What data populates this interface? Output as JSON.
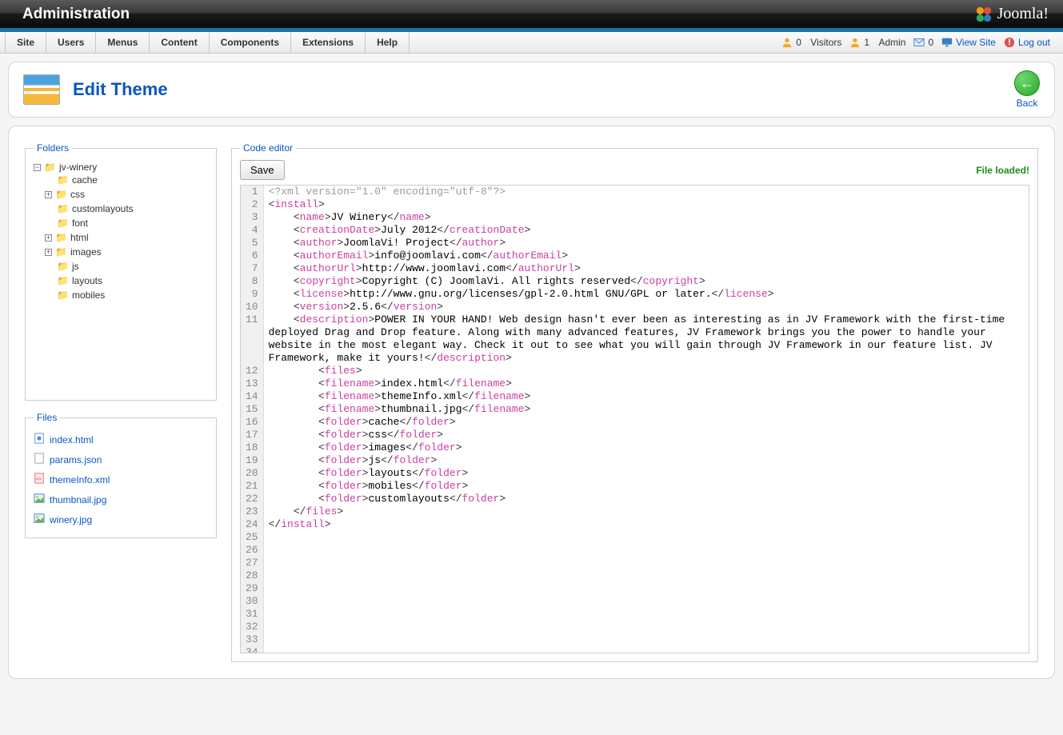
{
  "header": {
    "title": "Administration",
    "brand": "Joomla!"
  },
  "menu": {
    "items": [
      "Site",
      "Users",
      "Menus",
      "Content",
      "Components",
      "Extensions",
      "Help"
    ],
    "right": {
      "visitors_count": "0",
      "visitors_label": "Visitors",
      "admin_count": "1",
      "admin_label": "Admin",
      "mail_count": "0",
      "view_site": "View Site",
      "logout": "Log out"
    }
  },
  "page": {
    "title": "Edit Theme",
    "back_label": "Back"
  },
  "panels": {
    "folders_legend": "Folders",
    "files_legend": "Files",
    "editor_legend": "Code editor"
  },
  "tree": {
    "root": "jv-winery",
    "children": [
      {
        "name": "cache",
        "expandable": false
      },
      {
        "name": "css",
        "expandable": true
      },
      {
        "name": "customlayouts",
        "expandable": false
      },
      {
        "name": "font",
        "expandable": false
      },
      {
        "name": "html",
        "expandable": true
      },
      {
        "name": "images",
        "expandable": true
      },
      {
        "name": "js",
        "expandable": false
      },
      {
        "name": "layouts",
        "expandable": false
      },
      {
        "name": "mobiles",
        "expandable": false
      }
    ]
  },
  "files": [
    "index.html",
    "params.json",
    "themeInfo.xml",
    "thumbnail.jpg",
    "winery.jpg"
  ],
  "editor": {
    "save_label": "Save",
    "status": "File loaded!",
    "total_lines": 34,
    "code_lines": [
      {
        "n": 1,
        "type": "comment",
        "raw": "<?xml version=\"1.0\" encoding=\"utf-8\"?>"
      },
      {
        "n": 2,
        "indent": 0,
        "open": "install"
      },
      {
        "n": 3,
        "indent": 1,
        "open": "name",
        "text": "JV Winery",
        "close": "name"
      },
      {
        "n": 4,
        "indent": 1,
        "open": "creationDate",
        "text": "July 2012",
        "close": "creationDate"
      },
      {
        "n": 5,
        "indent": 1,
        "open": "author",
        "text": "JoomlaVi! Project",
        "close": "author"
      },
      {
        "n": 6,
        "indent": 1,
        "open": "authorEmail",
        "text": "info@joomlavi.com",
        "close": "authorEmail"
      },
      {
        "n": 7,
        "indent": 1,
        "open": "authorUrl",
        "text": "http://www.joomlavi.com",
        "close": "authorUrl"
      },
      {
        "n": 8,
        "indent": 1,
        "open": "copyright",
        "text": "Copyright (C) JoomlaVi. All rights reserved",
        "close": "copyright"
      },
      {
        "n": 9,
        "indent": 1,
        "open": "license",
        "text": "http://www.gnu.org/licenses/gpl-2.0.html GNU/GPL or later.",
        "close": "license"
      },
      {
        "n": 10,
        "indent": 1,
        "open": "version",
        "text": "2.5.6",
        "close": "version"
      },
      {
        "n": 11,
        "indent": 1,
        "open": "description",
        "text": "POWER IN YOUR HAND! Web design hasn't ever been as interesting as in JV Framework with the first-time deployed Drag and Drop feature. Along with many advanced features, JV Framework brings you the power to handle your website in the most elegant way. Check it out to see what you will gain through JV Framework in our feature list. JV Framework, make it yours!",
        "close": "description",
        "wrap": true
      },
      {
        "n": 12,
        "indent": 2,
        "open": "files"
      },
      {
        "n": 13,
        "indent": 2,
        "open": "filename",
        "text": "index.html",
        "close": "filename"
      },
      {
        "n": 14,
        "indent": 2,
        "open": "filename",
        "text": "themeInfo.xml",
        "close": "filename"
      },
      {
        "n": 15,
        "indent": 2,
        "open": "filename",
        "text": "thumbnail.jpg",
        "close": "filename"
      },
      {
        "n": 16,
        "indent": 2,
        "open": "folder",
        "text": "cache",
        "close": "folder"
      },
      {
        "n": 17,
        "indent": 2,
        "open": "folder",
        "text": "css",
        "close": "folder"
      },
      {
        "n": 18,
        "indent": 2,
        "open": "folder",
        "text": "images",
        "close": "folder"
      },
      {
        "n": 19,
        "indent": 2,
        "open": "folder",
        "text": "js",
        "close": "folder"
      },
      {
        "n": 20,
        "indent": 2,
        "open": "folder",
        "text": "layouts",
        "close": "folder"
      },
      {
        "n": 21,
        "indent": 2,
        "open": "folder",
        "text": "mobiles",
        "close": "folder"
      },
      {
        "n": 22,
        "indent": 2,
        "open": "folder",
        "text": "customlayouts",
        "close": "folder"
      },
      {
        "n": 23,
        "indent": 1,
        "close_only": "files"
      },
      {
        "n": 24,
        "indent": 0,
        "close_only": "install"
      }
    ]
  }
}
